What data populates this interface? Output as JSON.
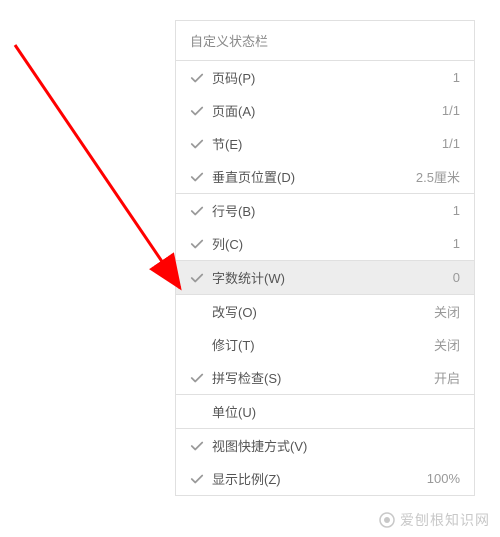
{
  "panel": {
    "title": "自定义状态栏",
    "groups": [
      [
        {
          "checked": true,
          "label": "页码(P)",
          "value": "1",
          "highlighted": false
        },
        {
          "checked": true,
          "label": "页面(A)",
          "value": "1/1",
          "highlighted": false
        },
        {
          "checked": true,
          "label": "节(E)",
          "value": "1/1",
          "highlighted": false
        },
        {
          "checked": true,
          "label": "垂直页位置(D)",
          "value": "2.5厘米",
          "highlighted": false
        }
      ],
      [
        {
          "checked": true,
          "label": "行号(B)",
          "value": "1",
          "highlighted": false
        },
        {
          "checked": true,
          "label": "列(C)",
          "value": "1",
          "highlighted": false
        }
      ],
      [
        {
          "checked": true,
          "label": "字数统计(W)",
          "value": "0",
          "highlighted": true
        }
      ],
      [
        {
          "checked": false,
          "label": "改写(O)",
          "value": "关闭",
          "highlighted": false
        },
        {
          "checked": false,
          "label": "修订(T)",
          "value": "关闭",
          "highlighted": false
        },
        {
          "checked": true,
          "label": "拼写检查(S)",
          "value": "开启",
          "highlighted": false
        }
      ],
      [
        {
          "checked": false,
          "label": "单位(U)",
          "value": "",
          "highlighted": false
        }
      ],
      [
        {
          "checked": true,
          "label": "视图快捷方式(V)",
          "value": "",
          "highlighted": false
        },
        {
          "checked": true,
          "label": "显示比例(Z)",
          "value": "100%",
          "highlighted": false
        }
      ]
    ]
  },
  "watermark": "爱刨根知识网"
}
